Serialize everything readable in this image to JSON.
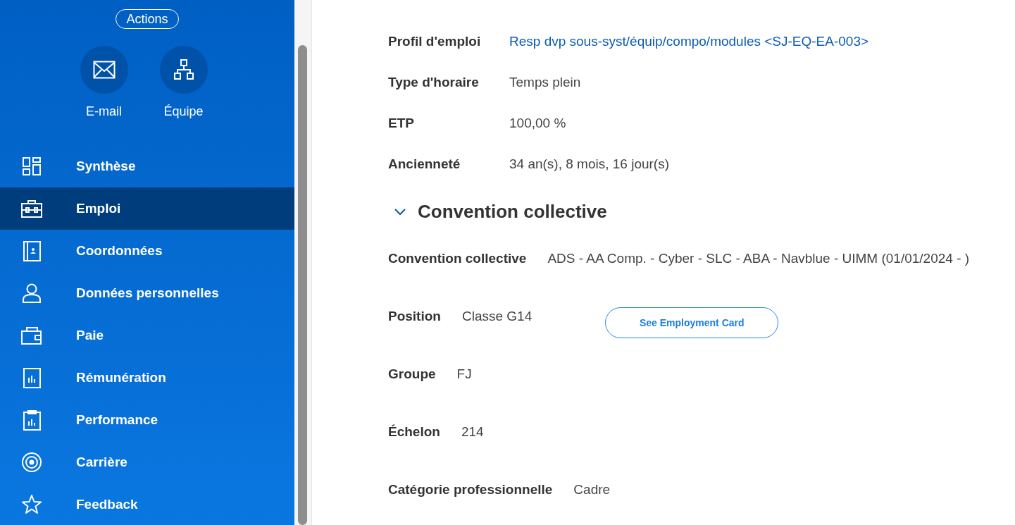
{
  "sidebar": {
    "actions_button": "Actions",
    "quick_actions": [
      {
        "label": "E-mail"
      },
      {
        "label": "Équipe"
      }
    ],
    "items": [
      {
        "label": "Synthèse",
        "selected": false
      },
      {
        "label": "Emploi",
        "selected": true
      },
      {
        "label": "Coordonnées",
        "selected": false
      },
      {
        "label": "Données personnelles",
        "selected": false
      },
      {
        "label": "Paie",
        "selected": false
      },
      {
        "label": "Rémunération",
        "selected": false
      },
      {
        "label": "Performance",
        "selected": false
      },
      {
        "label": "Carrière",
        "selected": false
      },
      {
        "label": "Feedback",
        "selected": false
      }
    ]
  },
  "job_fields": [
    {
      "label": "Profil d'emploi",
      "value": "Resp dvp sous-syst/équip/compo/modules <SJ-EQ-EA-003>",
      "kind": "link"
    },
    {
      "label": "Type d'horaire",
      "value": "Temps plein",
      "kind": "text"
    },
    {
      "label": "ETP",
      "value": "100,00 %",
      "kind": "text"
    },
    {
      "label": "Ancienneté",
      "value": "34 an(s), 8 mois, 16 jour(s)",
      "kind": "text"
    }
  ],
  "section": {
    "title": "Convention collective",
    "expanded": true,
    "fields": [
      {
        "label": "Convention collective",
        "value": "ADS - AA Comp. - Cyber - SLC - ABA - Navblue - UIMM (01/01/2024 - )"
      },
      {
        "label": "Position",
        "value": "Classe G14",
        "button": "See Employment Card"
      },
      {
        "label": "Groupe",
        "value": "FJ"
      },
      {
        "label": "Échelon",
        "value": "214"
      },
      {
        "label": "Catégorie professionnelle",
        "value": "Cadre"
      }
    ]
  }
}
